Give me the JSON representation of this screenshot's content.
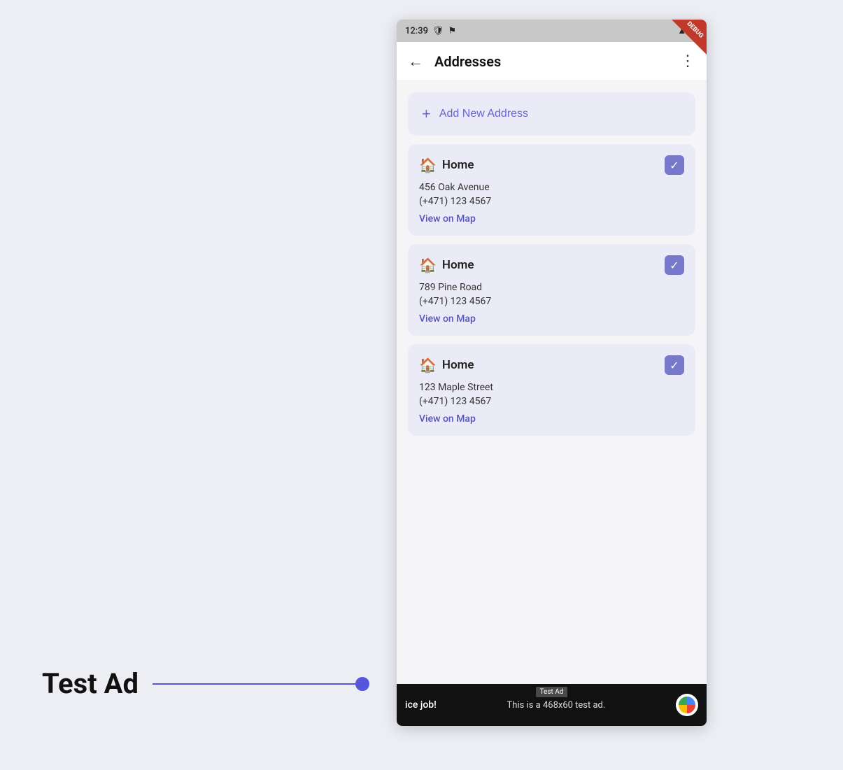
{
  "page": {
    "background_color": "#eceef4"
  },
  "status_bar": {
    "time": "12:39",
    "debug_label": "DEBUG"
  },
  "app_bar": {
    "title": "Addresses",
    "back_icon": "←",
    "more_icon": "⋮"
  },
  "add_address": {
    "plus_icon": "+",
    "label": "Add New Address"
  },
  "addresses": [
    {
      "type": "Home",
      "street": "456 Oak Avenue",
      "phone": "(+471) 123 4567",
      "view_on_map": "View on Map",
      "checked": true
    },
    {
      "type": "Home",
      "street": "789 Pine Road",
      "phone": "(+471) 123 4567",
      "view_on_map": "View on Map",
      "checked": true
    },
    {
      "type": "Home",
      "street": "123 Maple Street",
      "phone": "(+471) 123 4567",
      "view_on_map": "View on Map",
      "checked": true
    }
  ],
  "ad": {
    "label": "Test Ad",
    "nice_job": "ice job!",
    "description": "This is a 468x60 test ad."
  },
  "test_ad_section": {
    "label": "Test Ad"
  }
}
